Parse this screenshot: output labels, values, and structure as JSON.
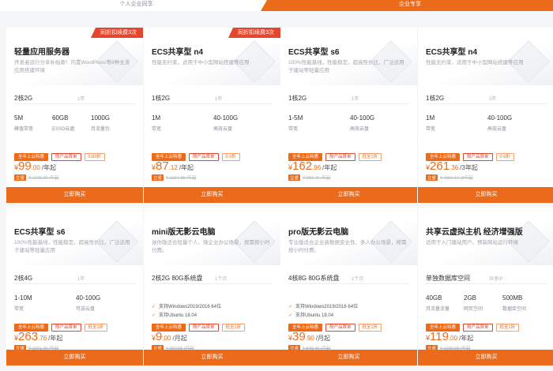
{
  "tabs": [
    "个人企业同享",
    "企业专享"
  ],
  "buy_label": "立即购买",
  "cards": [
    {
      "ribbon": "同折扣续费3次",
      "title": "轻量应用服务器",
      "desc": "开发者运行分享补贴款！内置WordPress等8种主流应用搭建环境",
      "spec": "2核2G",
      "spec_note": "1年",
      "cells": [
        {
          "v": "5M",
          "l": "峰值带宽"
        },
        {
          "v": "60GB",
          "l": "ESSD云盘"
        },
        {
          "v": "1000G",
          "l": "月流量包"
        }
      ],
      "badges": [
        "全年上云特惠",
        "限产品首单",
        "0.83折"
      ],
      "price_int": "99",
      "price_dec": ".00",
      "unit": "/年起",
      "orig_tag": "立省",
      "orig": "¥ 1020.00 /年起"
    },
    {
      "ribbon": "同折扣续费3次",
      "title": "ECS共享型 n4",
      "desc": "性能无约束，适用于中小型网站搭建等应用",
      "spec": "1核2G",
      "spec_note": "1年",
      "cells": [
        {
          "v": "1M",
          "l": "带宽"
        },
        {
          "v": "40-100G",
          "l": "高效云盘"
        }
      ],
      "badges": [
        "全年上云特惠",
        "限产品首单",
        "0.6折"
      ],
      "price_int": "87",
      "price_dec": ".12",
      "unit": "/年起",
      "orig_tag": "立省",
      "orig": "¥ 1364.88 /年起"
    },
    {
      "ribbon": "",
      "title": "ECS共享型 s6",
      "desc": "100%性能基线，性能稳定，超高性价比，广泛适用于建站等轻量应用",
      "spec": "1核2G",
      "spec_note": "1年",
      "cells": [
        {
          "v": "1-5M",
          "l": "带宽"
        },
        {
          "v": "40-100G",
          "l": "高效云盘"
        }
      ],
      "badges": [
        "全年上云特惠",
        "限产品首单",
        "低至1折"
      ],
      "price_int": "162",
      "price_dec": ".96",
      "unit": "/年起",
      "orig_tag": "立省",
      "orig": "¥ 983.40 /年起"
    },
    {
      "ribbon": "",
      "title": "ECS共享型 n4",
      "desc": "性能无约束，适用于中小型网站搭建等应用",
      "spec": "1核2G",
      "spec_note": "3年",
      "cells": [
        {
          "v": "1M",
          "l": "带宽"
        },
        {
          "v": "40-100G",
          "l": "高效云盘"
        }
      ],
      "badges": [
        "全年上云特惠",
        "限产品首单",
        "0.6折"
      ],
      "price_int": "261",
      "price_dec": ".36",
      "unit": "/3年起",
      "orig_tag": "立省",
      "orig": "¥ 4094.64 /3年起"
    },
    {
      "ribbon": "",
      "title": "ECS共享型 s6",
      "desc": "100%性能基线，性能稳定，超高性价比，广泛适用于建站等轻量应用",
      "spec": "2核4G",
      "spec_note": "1年",
      "cells": [
        {
          "v": "1-10M",
          "l": "带宽"
        },
        {
          "v": "40-100G",
          "l": "可选云盘"
        }
      ],
      "badges": [
        "全年上云特惠",
        "限产品首单",
        "低至1折"
      ],
      "price_int": "263",
      "price_dec": ".76",
      "unit": "/年起",
      "orig_tag": "立省",
      "orig": "¥ 1601.40 /年起"
    },
    {
      "ribbon": "",
      "title": "mini版无影云电脑",
      "desc": "迷你版适合轻量个人、微企业办公场景，按需按小时付费。",
      "spec": "2核2G 80G系统盘",
      "spec_note": "1个月",
      "features": [
        "支持Windows2019/2016 64位",
        "支持Ubuntu 18.04"
      ],
      "badges": [
        "全年上云特惠",
        "限产品首单",
        "低至1折"
      ],
      "price_int": "9",
      "price_dec": ".00",
      "unit": "/月起",
      "orig_tag": "立省",
      "orig": "¥ 250.95 /月起"
    },
    {
      "ribbon": "",
      "title": "pro版无影云电脑",
      "desc": "专业版适合企业高数据安全性、多人办公场景，按需按小时付费。",
      "spec": "4核8G 80G系统盘",
      "spec_note": "1个月",
      "features": [
        "支持Windows2019/2016 64位",
        "支持Ubuntu 18.04"
      ],
      "badges": [
        "全年上云特惠",
        "限产品首单",
        "低至1折"
      ],
      "price_int": "39",
      "price_dec": ".90",
      "unit": "/月起",
      "orig_tag": "立省",
      "orig": "¥ 545.40 /月起"
    },
    {
      "ribbon": "",
      "title": "共享云虚拟主机 经济增强版",
      "desc": "适用于入门建站用户，预装网站运行环境",
      "spec": "单独数据库空间",
      "spec_note": "共享IP",
      "cells": [
        {
          "v": "40GB",
          "l": "月流量流量"
        },
        {
          "v": "2GB",
          "l": "网页空间"
        },
        {
          "v": "500MB",
          "l": "数据库空间"
        }
      ],
      "badges": [
        "全年上云特惠",
        "限产品首单",
        "低至1折"
      ],
      "price_int": "119",
      "price_dec": ".00",
      "unit": "/年起",
      "orig_tag": "立省",
      "orig": "¥ 1200.00 /年起"
    }
  ],
  "colors": {
    "accent": "#ec6b1b",
    "ribbon": "#e4472e"
  }
}
